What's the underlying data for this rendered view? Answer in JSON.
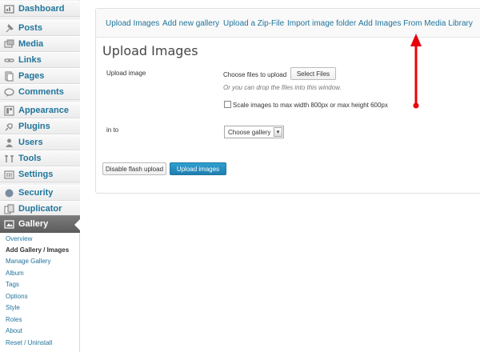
{
  "sidebar": {
    "items": [
      {
        "label": "Dashboard",
        "icon": "dashboard-icon"
      },
      {
        "label": "Posts",
        "icon": "pin-icon"
      },
      {
        "label": "Media",
        "icon": "media-icon"
      },
      {
        "label": "Links",
        "icon": "link-icon"
      },
      {
        "label": "Pages",
        "icon": "page-icon"
      },
      {
        "label": "Comments",
        "icon": "comment-icon"
      },
      {
        "label": "Appearance",
        "icon": "appearance-icon"
      },
      {
        "label": "Plugins",
        "icon": "plugin-icon"
      },
      {
        "label": "Users",
        "icon": "users-icon"
      },
      {
        "label": "Tools",
        "icon": "tools-icon"
      },
      {
        "label": "Settings",
        "icon": "settings-icon"
      },
      {
        "label": "Security",
        "icon": "shield-icon"
      },
      {
        "label": "Duplicator",
        "icon": "duplicator-icon"
      },
      {
        "label": "Gallery",
        "icon": "gallery-icon"
      }
    ],
    "submenu": [
      "Overview",
      "Add Gallery / Images",
      "Manage Gallery",
      "Album",
      "Tags",
      "Options",
      "Style",
      "Roles",
      "About",
      "Reset / Uninstall"
    ],
    "active_item": "Gallery",
    "current_submenu": "Add Gallery / Images"
  },
  "tabs": [
    "Upload Images",
    "Add new gallery",
    "Upload a Zip-File",
    "Import image folder",
    "Add Images From Media Library"
  ],
  "main": {
    "title": "Upload Images",
    "upload_label": "Upload image",
    "choose_files_text": "Choose files to upload",
    "select_files_button": "Select Files",
    "drop_hint": "Or you can drop the files into this window.",
    "scale_checkbox_label": "Scale images to max width 800px or max height 600px",
    "scale_checked": false,
    "into_label": "in to",
    "gallery_select_value": "Choose gallery",
    "disable_flash_button": "Disable flash upload",
    "upload_button": "Upload images"
  },
  "colors": {
    "link": "#21759b",
    "primary_button": "#2a95c5",
    "annotation_arrow": "#e8000b",
    "active_menu": "#6d6d6d"
  }
}
